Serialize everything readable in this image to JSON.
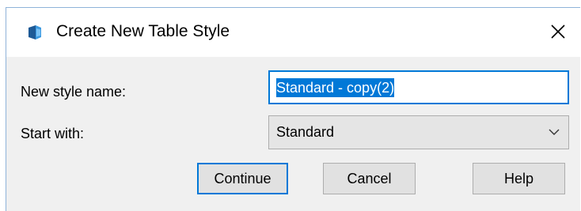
{
  "dialog": {
    "title": "Create New Table Style",
    "close_glyph": "✕"
  },
  "form": {
    "name_label": "New style name:",
    "name_value": "Standard - copy(2)",
    "start_label": "Start with:",
    "start_value": "Standard"
  },
  "buttons": {
    "continue": "Continue",
    "cancel": "Cancel",
    "help": "Help"
  },
  "icons": {
    "app": "table-style-app-icon",
    "close": "close-icon",
    "dropdown": "chevron-down-icon"
  },
  "colors": {
    "accent": "#0078d7",
    "dialog_bg": "#f0f0f0",
    "button_bg": "#e1e1e1"
  }
}
